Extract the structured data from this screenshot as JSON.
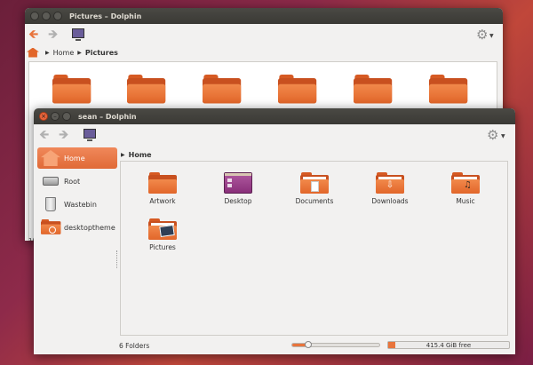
{
  "back_window": {
    "title": "Pictures – Dolphin",
    "breadcrumb": [
      "Home",
      "Pictures"
    ],
    "status_fragment": "1("
  },
  "front_window": {
    "title": "sean – Dolphin",
    "breadcrumb": [
      "Home"
    ],
    "sidebar": [
      {
        "label": "Home",
        "icon": "home-icon",
        "active": true
      },
      {
        "label": "Root",
        "icon": "drive-icon",
        "active": false
      },
      {
        "label": "Wastebin",
        "icon": "trash-icon",
        "active": false
      },
      {
        "label": "desktoptheme",
        "icon": "folder-search-icon",
        "active": false
      }
    ],
    "folders": [
      {
        "label": "Artwork",
        "icon": "folder-icon"
      },
      {
        "label": "Desktop",
        "icon": "folder-desktop-icon"
      },
      {
        "label": "Documents",
        "icon": "folder-documents-icon"
      },
      {
        "label": "Downloads",
        "icon": "folder-downloads-icon"
      },
      {
        "label": "Music",
        "icon": "folder-music-icon"
      },
      {
        "label": "Pictures",
        "icon": "folder-pictures-icon"
      }
    ],
    "status": {
      "count_text": "6 Folders",
      "zoom_level": 0.18,
      "free_space_text": "415.4 GiB free",
      "used_fraction": 0.06
    }
  },
  "colors": {
    "accent": "#e8743c",
    "folder": "#e2662a",
    "desktop_folder": "#9b3d8c",
    "titlebar": "#3c3b37"
  }
}
